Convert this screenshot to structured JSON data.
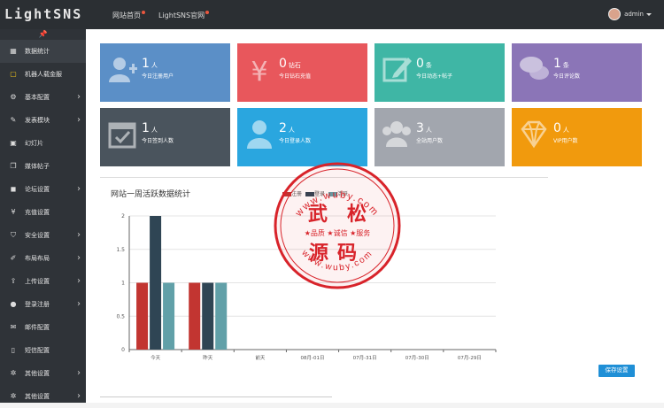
{
  "header": {
    "logo": "LightSNS",
    "links": [
      {
        "label": "网站首页"
      },
      {
        "label": "LightSNS官网"
      }
    ],
    "user": "admin"
  },
  "sidebar": {
    "items": [
      {
        "label": "数据统计",
        "icon": "bar-chart-icon",
        "active": true,
        "arrow": false
      },
      {
        "label": "机器人载金服",
        "icon": "chat-icon",
        "active": false,
        "arrow": false
      },
      {
        "label": "基本配置",
        "icon": "gear-icon",
        "active": false,
        "arrow": true
      },
      {
        "label": "发表模块",
        "icon": "pencil-icon",
        "active": false,
        "arrow": true
      },
      {
        "label": "幻灯片",
        "icon": "image-icon",
        "active": false,
        "arrow": false
      },
      {
        "label": "媒体帖子",
        "icon": "copy-icon",
        "active": false,
        "arrow": false
      },
      {
        "label": "论坛设置",
        "icon": "comments-icon",
        "active": false,
        "arrow": true
      },
      {
        "label": "充值设置",
        "icon": "yen-icon",
        "active": false,
        "arrow": false
      },
      {
        "label": "安全设置",
        "icon": "shield-icon",
        "active": false,
        "arrow": true
      },
      {
        "label": "布局布局",
        "icon": "brush-icon",
        "active": false,
        "arrow": true
      },
      {
        "label": "上传设置",
        "icon": "upload-icon",
        "active": false,
        "arrow": true
      },
      {
        "label": "登录注册",
        "icon": "user-icon",
        "active": false,
        "arrow": true
      },
      {
        "label": "邮件配置",
        "icon": "envelope-icon",
        "active": false,
        "arrow": false
      },
      {
        "label": "短信配置",
        "icon": "phone-icon",
        "active": false,
        "arrow": false
      },
      {
        "label": "其他设置",
        "icon": "cogs-icon",
        "active": false,
        "arrow": true
      },
      {
        "label": "其他设置",
        "icon": "cogs-icon",
        "active": false,
        "arrow": true
      }
    ]
  },
  "stats": [
    {
      "num": "1",
      "unit": "人",
      "label": "今日注册用户",
      "color": "#5b8fc7",
      "icon": "user-add-icon"
    },
    {
      "num": "0",
      "unit": "钻石",
      "label": "今日钻石充值",
      "color": "#e8575c",
      "icon": "yen-icon"
    },
    {
      "num": "0",
      "unit": "条",
      "label": "今日动态+帖子",
      "color": "#3fb6a5",
      "icon": "edit-icon"
    },
    {
      "num": "1",
      "unit": "条",
      "label": "今日评论数",
      "color": "#8b75b7",
      "icon": "comments-icon"
    },
    {
      "num": "1",
      "unit": "人",
      "label": "今日签到人数",
      "color": "#4a545d",
      "icon": "calendar-check-icon"
    },
    {
      "num": "2",
      "unit": "人",
      "label": "今日登录人数",
      "color": "#2aa6df",
      "icon": "user-icon"
    },
    {
      "num": "3",
      "unit": "人",
      "label": "全站用户数",
      "color": "#a2a6ae",
      "icon": "users-icon"
    },
    {
      "num": "0",
      "unit": "人",
      "label": "VIP用户数",
      "color": "#f19a0d",
      "icon": "diamond-icon"
    }
  ],
  "chart_data": {
    "type": "bar",
    "title": "网站一周活跃数据统计",
    "categories": [
      "今天",
      "昨天",
      "前天",
      "08月-01日",
      "07月-31日",
      "07月-30日",
      "07月-29日"
    ],
    "series": [
      {
        "name": "注册",
        "color": "#c23531",
        "values": [
          1,
          1,
          0,
          0,
          0,
          0,
          0
        ]
      },
      {
        "name": "登录",
        "color": "#2f4554",
        "values": [
          2,
          1,
          0,
          0,
          0,
          0,
          0
        ]
      },
      {
        "name": "活跃",
        "color": "#61a0a8",
        "values": [
          1,
          1,
          0,
          0,
          0,
          0,
          0
        ]
      }
    ],
    "ylim": [
      0,
      2
    ],
    "yticks": [
      "0",
      "0.5",
      "1",
      "1.5",
      "2"
    ],
    "legend_position": "top"
  },
  "watermark": {
    "top_text": "www.wuby.com",
    "big_left": "武",
    "big_right": "松",
    "slogan": "★品质 ★诚信 ★服务",
    "big_bottom": "源码",
    "bottom_text": "www.wuby.com"
  },
  "save_label": "保存设置"
}
